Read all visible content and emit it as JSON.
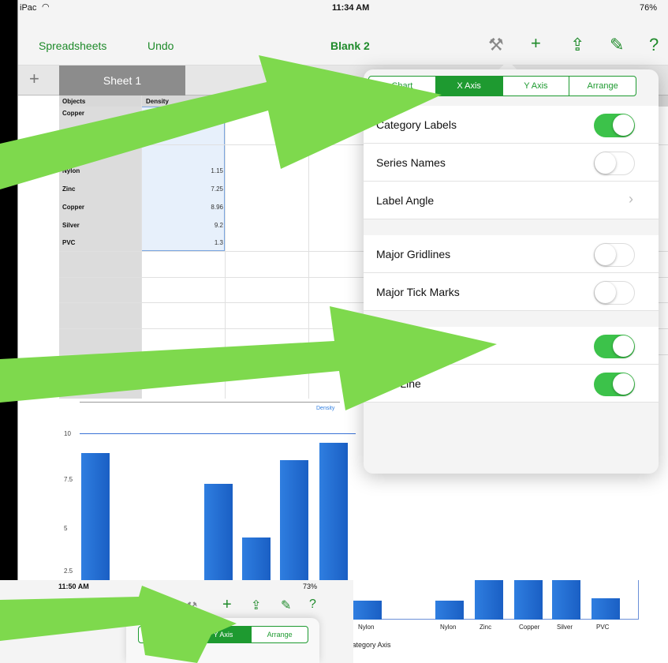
{
  "status": {
    "carrier": "iPac",
    "wifi": "wifi-icon",
    "time": "11:34 AM",
    "battery": "76%"
  },
  "navbar": {
    "spreadsheets": "Spreadsheets",
    "undo": "Undo",
    "title": "Blank 2"
  },
  "sheet_tab": {
    "label": "Sheet 1"
  },
  "table": {
    "headers": [
      "Objects",
      "Density"
    ],
    "rows": [
      {
        "name": "Copper",
        "value": ""
      },
      {
        "name": "Nylon",
        "value": "1.15"
      },
      {
        "name": "Zinc",
        "value": "7.25"
      },
      {
        "name": "Copper",
        "value": "8.96"
      },
      {
        "name": "Silver",
        "value": "9.2"
      },
      {
        "name": "PVC",
        "value": "1.3"
      }
    ]
  },
  "popover": {
    "tabs": [
      "Chart",
      "X Axis",
      "Y Axis",
      "Arrange"
    ],
    "active_tab": "X Axis",
    "rows": [
      {
        "label": "Category Labels",
        "control": "toggle",
        "on": true
      },
      {
        "label": "Series Names",
        "control": "toggle",
        "on": false
      },
      {
        "label": "Label Angle",
        "control": "chevron"
      },
      {
        "label": "Major Gridlines",
        "control": "toggle",
        "on": false
      },
      {
        "label": "Major Tick Marks",
        "control": "toggle",
        "on": false
      },
      {
        "label": "",
        "control": "toggle",
        "on": true
      },
      {
        "label": "Axis Line",
        "control": "toggle",
        "on": true
      }
    ]
  },
  "mini_chart": {
    "legend": "Density",
    "y_ticks": [
      "10",
      "7.5",
      "5",
      "2.5"
    ]
  },
  "chart_data": {
    "type": "bar",
    "categories": [
      "Nylon",
      "Nylon",
      "Zinc",
      "Copper",
      "Silver",
      "PVC"
    ],
    "values": [
      1.15,
      1.15,
      7.25,
      8.96,
      9.2,
      1.3
    ],
    "xlabel": "Category Axis",
    "ylim": [
      0,
      10
    ]
  },
  "third": {
    "time": "11:50 AM",
    "battery": "73%",
    "tabs": [
      "Axis",
      "Y Axis",
      "Arrange"
    ],
    "active_tab": "Y Axis"
  },
  "colors": {
    "accent": "#1e9a30",
    "toggle_on": "#3cc24a",
    "arrow": "#7ed94d",
    "bar": "#2f7ee0"
  }
}
